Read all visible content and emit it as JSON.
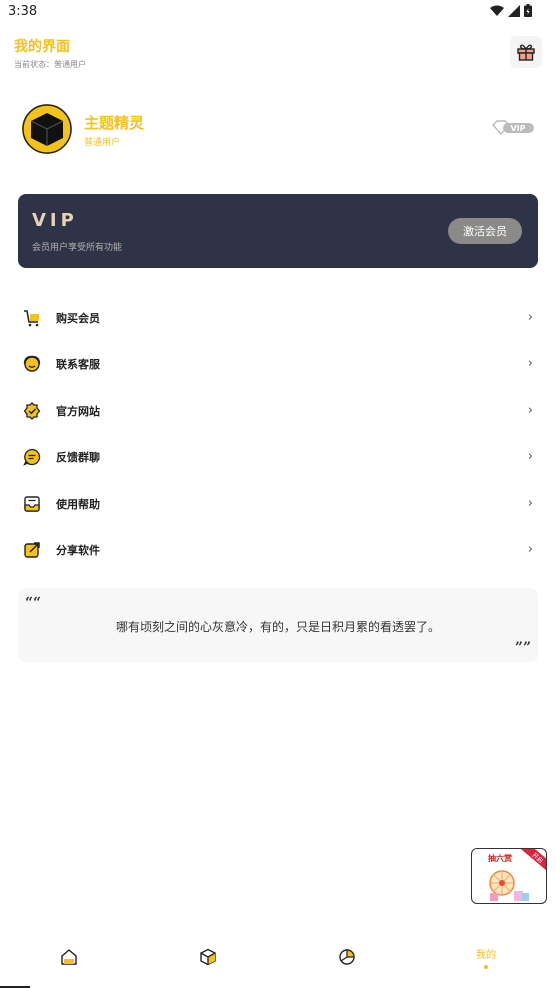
{
  "status_bar": {
    "time": "3:38"
  },
  "header": {
    "title": "我的界面",
    "status": "当前状态：普通用户"
  },
  "profile": {
    "name": "主题精灵",
    "level": "普通用户",
    "badge": "VIP"
  },
  "vip_card": {
    "title": "VIP",
    "description": "会员用户享受所有功能",
    "activate_label": "激活会员"
  },
  "menu": {
    "items": [
      {
        "label": "购买会员",
        "icon": "cart-icon"
      },
      {
        "label": "联系客服",
        "icon": "support-icon"
      },
      {
        "label": "官方网站",
        "icon": "verified-site-icon"
      },
      {
        "label": "反馈群聊",
        "icon": "chat-icon"
      },
      {
        "label": "使用帮助",
        "icon": "inbox-help-icon"
      },
      {
        "label": "分享软件",
        "icon": "share-icon"
      }
    ],
    "arrow": "›"
  },
  "quote": {
    "open_mark": "““",
    "text": "哪有顷刻之间的心灰意冷，有的，只是日积月累的看透罢了。",
    "close_mark": "””"
  },
  "promo": {
    "title": "抽六赏",
    "corner": "开启"
  },
  "bottom_nav": {
    "active_label": "我的",
    "items": [
      "home-icon",
      "cube-icon",
      "chart-icon",
      "profile"
    ]
  },
  "colors": {
    "accent": "#f5c21b",
    "vip_card_bg": "#2e3348",
    "vip_title": "#e8d2b4"
  }
}
